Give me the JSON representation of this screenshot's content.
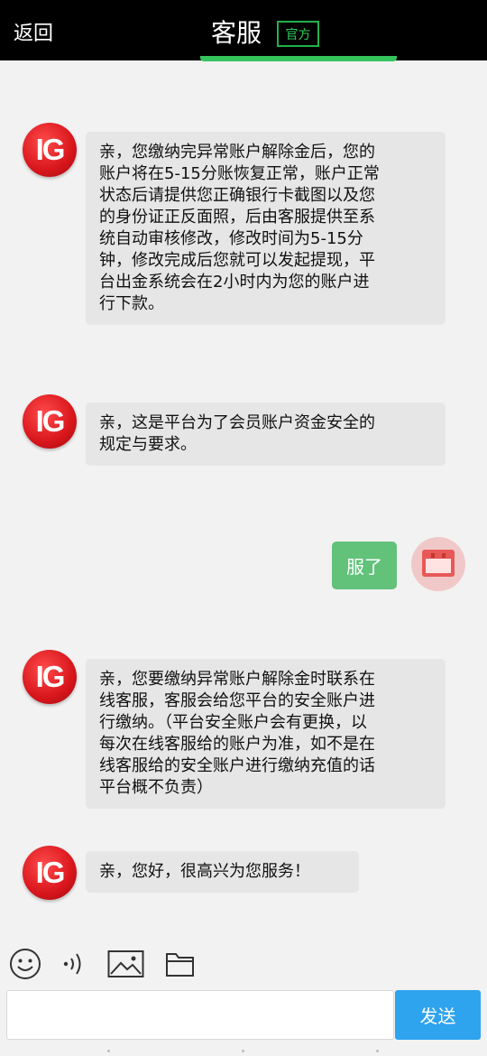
{
  "header": {
    "back_label": "返回",
    "title": "客服",
    "badge": "官方"
  },
  "messages": [
    {
      "avatar": "IG",
      "text": "亲，您缴纳完异常账户解除金后，您的\n账户将在5-15分账恢复正常，账户正常\n状态后请提供您正确银行卡截图以及您\n的身份证正反面照，后由客服提供至系\n统自动审核修改，修改时间为5-15分\n钟，修改完成后您就可以发起提现，平\n台出金系统会在2小时内为您的账户进\n行下款。"
    },
    {
      "avatar": "IG",
      "text": "亲，这是平台为了会员账户资金安全的\n规定与要求。"
    },
    {
      "avatar": "IG",
      "text": "亲，您要缴纳异常账户解除金时联系在\n线客服，客服会给您平台的安全账户进\n行缴纳。（平台安全账户会有更换，以\n每次在线客服给的账户为准，如不是在\n线客服给的安全账户进行缴纳充值的话\n平台概不负责）"
    },
    {
      "avatar": "IG",
      "text": "亲，您好，很高兴为您服务！"
    }
  ],
  "user_message": {
    "text": "服了"
  },
  "toolbar": {
    "icons": [
      "emoji-icon",
      "voice-icon",
      "image-icon",
      "folder-icon"
    ]
  },
  "composer": {
    "placeholder": "",
    "send_label": "发送"
  },
  "colors": {
    "header_bg": "#000000",
    "badge_green": "#22b14c",
    "user_bubble": "#62c27a",
    "send_button": "#2ea3ee",
    "brand_red": "#d8161c"
  }
}
